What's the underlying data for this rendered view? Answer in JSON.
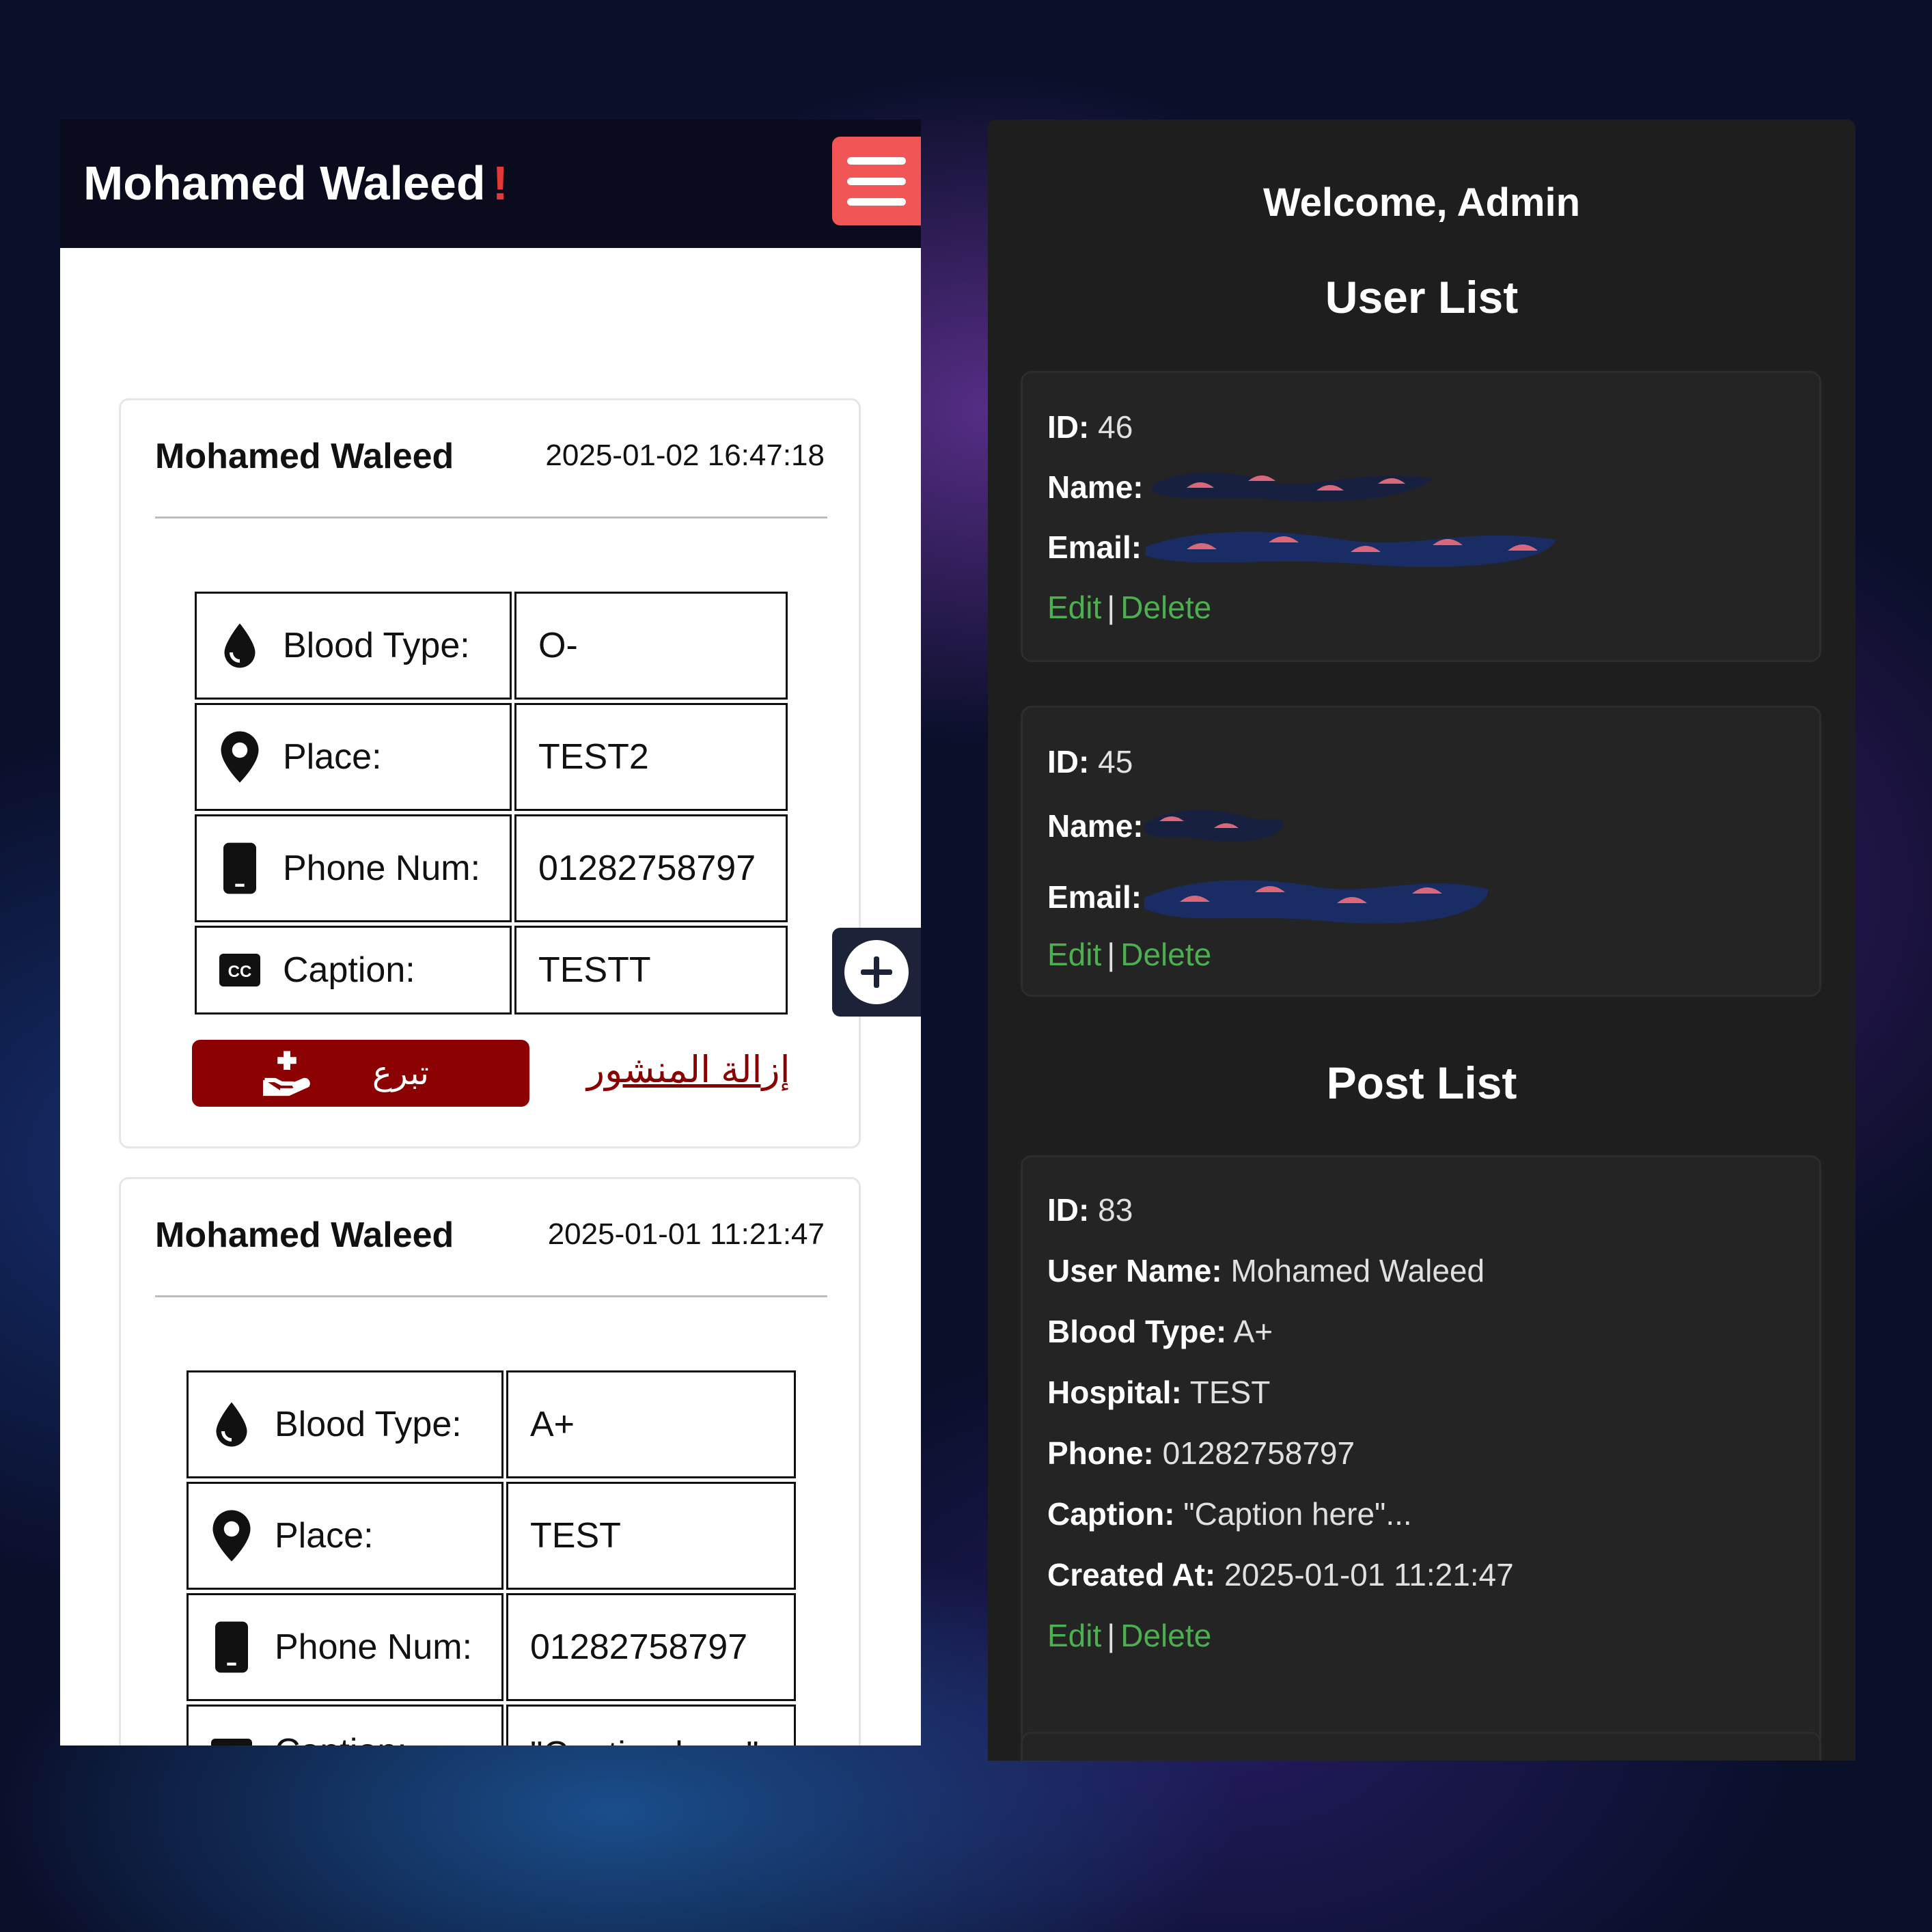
{
  "left": {
    "brand": "Mohamed Waleed",
    "brand_mark": "!",
    "posts": [
      {
        "author": "Mohamed Waleed",
        "date": "2025-01-02 16:47:18",
        "rows": [
          {
            "icon": "blood-drop-icon",
            "label": "Blood Type:",
            "value": "O-"
          },
          {
            "icon": "location-pin-icon",
            "label": "Place:",
            "value": "TEST2"
          },
          {
            "icon": "phone-icon",
            "label": "Phone Num:",
            "value": "01282758797"
          },
          {
            "icon": "closed-caption-icon",
            "label": "Caption:",
            "value": "TESTT"
          }
        ],
        "donate_label": "تبرع",
        "remove_label": "إزالة المنشور"
      },
      {
        "author": "Mohamed Waleed",
        "date": "2025-01-01 11:21:47",
        "rows": [
          {
            "icon": "blood-drop-icon",
            "label": "Blood Type:",
            "value": "A+"
          },
          {
            "icon": "location-pin-icon",
            "label": "Place:",
            "value": "TEST"
          },
          {
            "icon": "phone-icon",
            "label": "Phone Num:",
            "value": "01282758797"
          },
          {
            "icon": "closed-caption-icon",
            "label": "Caption:",
            "value": "\"Caption here\""
          }
        ]
      }
    ]
  },
  "right": {
    "welcome": "Welcome, Admin",
    "user_list_title": "User List",
    "post_list_title": "Post List",
    "labels": {
      "id": "ID:",
      "name": "Name:",
      "email": "Email:",
      "user_name": "User Name:",
      "blood_type": "Blood Type:",
      "hospital": "Hospital:",
      "phone": "Phone:",
      "caption": "Caption:",
      "created_at": "Created At:",
      "edit": "Edit",
      "separator": "|",
      "delete": "Delete"
    },
    "users": [
      {
        "id": "46"
      },
      {
        "id": "45"
      }
    ],
    "post": {
      "id": "83",
      "user_name": "Mohamed Waleed",
      "blood_type": "A+",
      "hospital": "TEST",
      "phone": "01282758797",
      "caption": "\"Caption here\"...",
      "created_at": "2025-01-01 11:21:47"
    }
  },
  "colors": {
    "brand_mark": "#e53935",
    "menu_button": "#f25555",
    "donate_button": "#8b0000",
    "link_green": "#4caf50",
    "admin_bg": "#1e1e1e"
  }
}
